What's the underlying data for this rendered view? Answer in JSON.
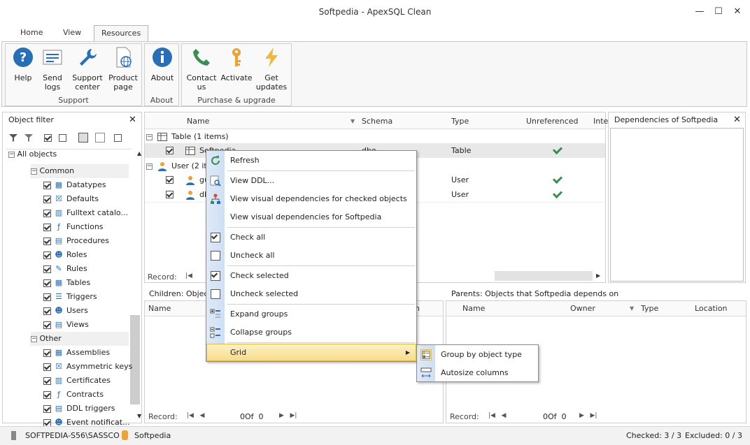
{
  "window": {
    "title": "Softpedia - ApexSQL Clean"
  },
  "ribbon_tabs": [
    "Home",
    "View",
    "Resources"
  ],
  "ribbon": {
    "support": {
      "label": "Support",
      "help": "Help",
      "send_logs_1": "Send",
      "send_logs_2": "logs",
      "support_center_1": "Support",
      "support_center_2": "center",
      "product_page_1": "Product",
      "product_page_2": "page"
    },
    "about": {
      "label": "About",
      "about": "About"
    },
    "purchase": {
      "label": "Purchase & upgrade",
      "contact_1": "Contact",
      "contact_2": "us",
      "activate": "Activate",
      "updates_1": "Get",
      "updates_2": "updates"
    }
  },
  "object_filter": {
    "title": "Object filter",
    "all_objects": "All objects",
    "common": "Common",
    "common_items": [
      "Datatypes",
      "Defaults",
      "Fulltext catalo...",
      "Functions",
      "Procedures",
      "Roles",
      "Rules",
      "Tables",
      "Triggers",
      "Users",
      "Views"
    ],
    "other": "Other",
    "other_items": [
      "Assemblies",
      "Asymmetric keys",
      "Certificates",
      "Contracts",
      "DDL triggers",
      "Event notificat..."
    ]
  },
  "grid": {
    "columns": [
      "Name",
      "Schema",
      "Type",
      "Unreferenced",
      "Inte"
    ],
    "group_table": "Table (1 items)",
    "group_user": "User (2 ite",
    "rows": [
      {
        "name": "Softpedia",
        "schema": "dbo",
        "type": "Table"
      },
      {
        "name": "gu",
        "schema": "",
        "type": "User"
      },
      {
        "name": "db",
        "schema": "",
        "type": "User"
      }
    ],
    "record_label": "Record:"
  },
  "deps": {
    "title": "Dependencies of Softpedia"
  },
  "children": {
    "title": "Children: Objec",
    "col_name": "Name",
    "col_partial": "n",
    "record_label": "Record:"
  },
  "parents": {
    "title": "Parents: Objects that Softpedia depends on",
    "columns": [
      "Name",
      "Owner",
      "Type",
      "Location"
    ],
    "record_label": "Record:",
    "counter_value": "0",
    "counter_of": "Of",
    "counter_total": "0"
  },
  "children_counter": {
    "value": "0",
    "of": "Of",
    "total": "0"
  },
  "context_menu": {
    "items": [
      "Refresh",
      "View DDL...",
      "View visual dependencies for checked objects",
      "View visual dependencies for Softpedia",
      "Check all",
      "Uncheck all",
      "Check selected",
      "Uncheck selected",
      "Expand groups",
      "Collapse groups",
      "Grid"
    ]
  },
  "submenu": {
    "items": [
      "Group by object type",
      "Autosize columns"
    ]
  },
  "statusbar": {
    "server": "SOFTPEDIA-S56\\SASSCO",
    "database": "Softpedia",
    "checked": "Checked: 3 / 3",
    "excluded": "Excluded: 0 / 3"
  },
  "colors": {
    "accent": "#3c8c53",
    "menu_highlight": "#f7dc8c",
    "selection": "#e8e8e8"
  }
}
